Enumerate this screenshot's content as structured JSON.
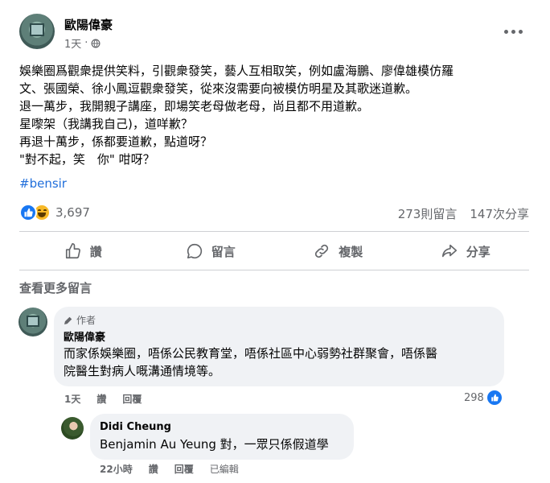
{
  "post": {
    "author": "歐陽偉豪",
    "time": "1天",
    "lines": [
      "娛樂圈爲觀衆提供笑料，引觀衆發笑，藝人互相取笑，例如盧海鵬、廖偉雄模仿羅",
      "文、張國榮、徐小鳳逗觀衆發笑，從來沒需要向被模仿明星及其歌迷道歉。",
      "退一萬步，我開親子講座，即場笑老母做老母，尚且都不用道歉。",
      "星嚟架（我講我自己)，道咩歉？",
      "再退十萬步，係都要道歉，點道呀？",
      "\"對不起，笑　你\" 咁呀？"
    ],
    "hashtag": "#bensir",
    "reaction_count": "3,697",
    "comments_count": "273則留言",
    "shares_count": "147次分享",
    "icons": [
      "globe-icon",
      "more-icon",
      "like-reaction-icon",
      "haha-reaction-icon"
    ]
  },
  "actions": {
    "like": "讚",
    "comment": "留言",
    "copy": "複製",
    "share": "分享"
  },
  "view_more": "查看更多留言",
  "comments": [
    {
      "badge": "作者",
      "name": "歐陽偉豪",
      "lines": [
        "而家係娛樂圈，唔係公民教育堂，唔係社區中心弱勢社群聚會，唔係醫",
        "院醫生對病人嘅溝通情境等。"
      ],
      "time": "1天",
      "like": "讚",
      "reply": "回覆",
      "likes": "298"
    },
    {
      "name": "Didi Cheung",
      "text": "Benjamin Au Yeung 對，一眾只係假道學",
      "time": "22小時",
      "like": "讚",
      "reply": "回覆",
      "edited": "已編輯"
    }
  ]
}
